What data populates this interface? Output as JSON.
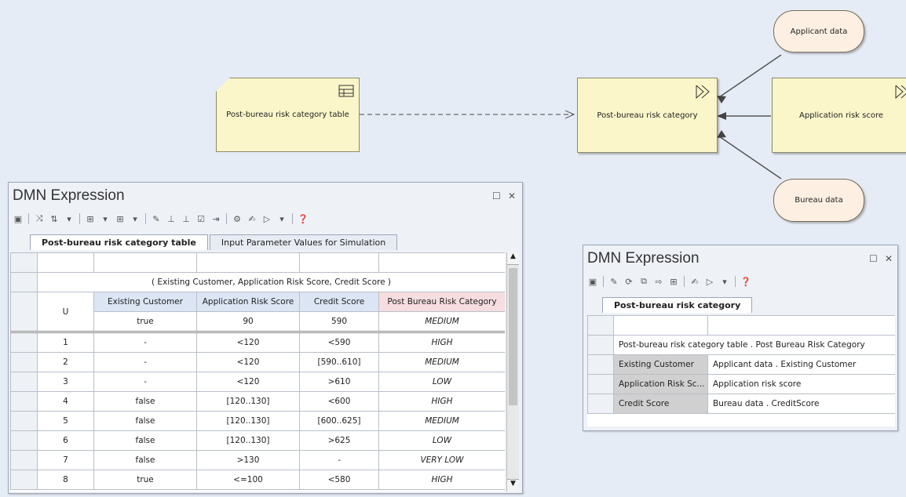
{
  "diagram": {
    "table_node": "Post-bureau risk category table",
    "decision_node": "Post-bureau risk category",
    "app_risk_node": "Application risk score",
    "applicant_node": "Applicant data",
    "bureau_node": "Bureau data"
  },
  "panel1": {
    "title": "DMN Expression",
    "tabs": [
      "Post-bureau risk category table",
      "Input Parameter Values for Simulation"
    ],
    "banner": "( Existing Customer, Application Risk Score, Credit Score )",
    "hit_policy": "U",
    "columns": [
      "Existing Customer",
      "Application Risk Score",
      "Credit Score",
      "Post Bureau Risk Category"
    ],
    "sample": [
      "true",
      "90",
      "590",
      "MEDIUM"
    ],
    "rows": [
      [
        "1",
        "-",
        "<120",
        "<590",
        "HIGH"
      ],
      [
        "2",
        "-",
        "<120",
        "[590..610]",
        "MEDIUM"
      ],
      [
        "3",
        "-",
        "<120",
        ">610",
        "LOW"
      ],
      [
        "4",
        "false",
        "[120..130]",
        "<600",
        "HIGH"
      ],
      [
        "5",
        "false",
        "[120..130]",
        "[600..625]",
        "MEDIUM"
      ],
      [
        "6",
        "false",
        "[120..130]",
        ">625",
        "LOW"
      ],
      [
        "7",
        "false",
        ">130",
        "-",
        "VERY LOW"
      ],
      [
        "8",
        "true",
        "<=100",
        "<580",
        "HIGH"
      ]
    ]
  },
  "panel2": {
    "title": "DMN Expression",
    "tab": "Post-bureau risk category",
    "header": "Post-bureau risk category table . Post Bureau Risk Category",
    "bindings": [
      [
        "Existing Customer",
        "Applicant data . Existing Customer"
      ],
      [
        "Application Risk Sc...",
        "Application risk score"
      ],
      [
        "Credit Score",
        "Bureau data . CreditScore"
      ]
    ]
  },
  "colors": {
    "canvas": "#e6ecf5",
    "node": "#fbf6c9",
    "oval": "#fdf0e2",
    "input_header": "#dbe5f4",
    "output_header": "#f6dde0"
  }
}
